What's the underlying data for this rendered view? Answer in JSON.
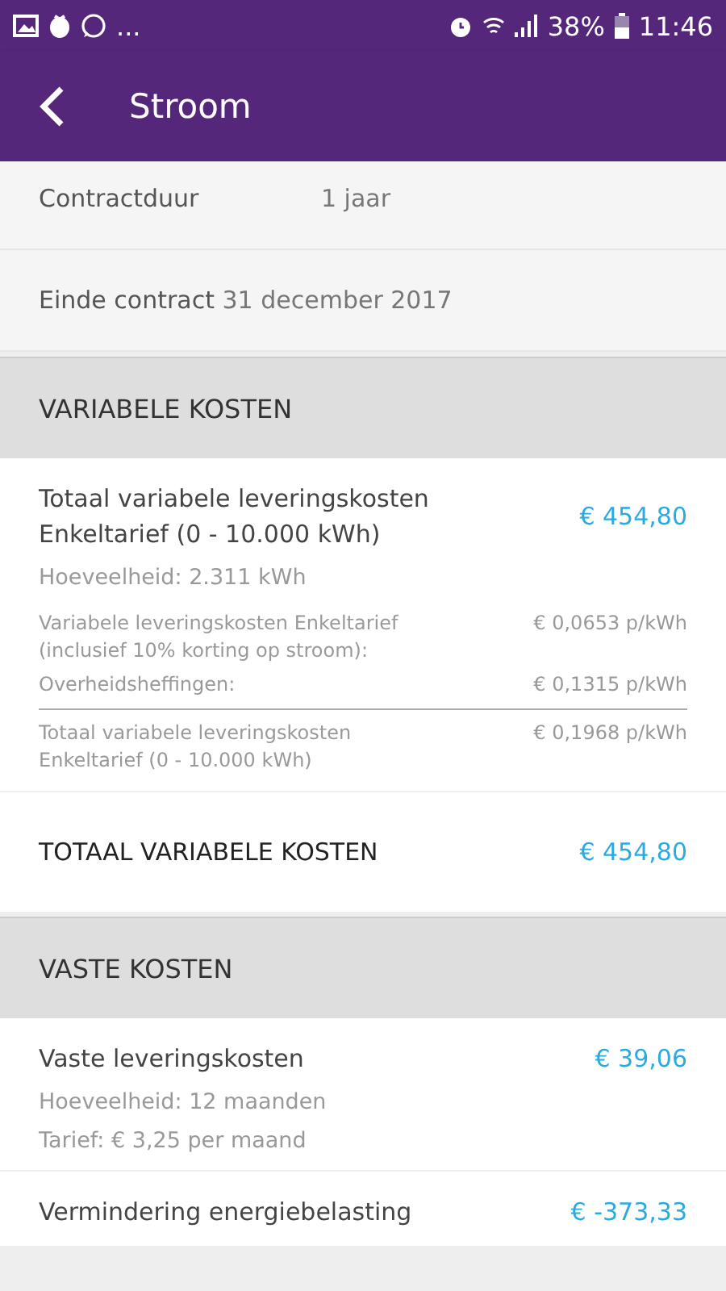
{
  "status_bar": {
    "more": "...",
    "battery": "38%",
    "time": "11:46"
  },
  "header": {
    "title": "Stroom"
  },
  "contract": [
    {
      "label": "Contractduur",
      "value": "1 jaar",
      "kind": "columns"
    },
    {
      "label": "Einde contract",
      "value": "31 december 2017",
      "kind": "inline"
    }
  ],
  "sections": [
    {
      "title": "VARIABELE KOSTEN",
      "items": [
        {
          "kind": "detail",
          "title": "Totaal variabele leveringskosten Enkeltarief (0 - 10.000 kWh)",
          "amount": "€ 454,80",
          "lines": [
            "Hoeveelheid: 2.311 kWh"
          ],
          "breakdown": [
            {
              "label": "Variabele leveringskosten Enkeltarief (inclusief 10% korting op stroom):",
              "value": "€ 0,0653 p/kWh",
              "total": false
            },
            {
              "label": "Overheidsheffingen:",
              "value": "€ 0,1315 p/kWh",
              "total": false
            },
            {
              "label": "Totaal variabele leveringskosten Enkeltarief (0 - 10.000 kWh)",
              "value": "€ 0,1968 p/kWh",
              "total": true
            }
          ]
        },
        {
          "kind": "total",
          "title": "TOTAAL VARIABELE KOSTEN",
          "amount": "€ 454,80"
        }
      ]
    },
    {
      "title": "VASTE KOSTEN",
      "items": [
        {
          "kind": "detail",
          "title": "Vaste leveringskosten",
          "amount": "€ 39,06",
          "lines": [
            "Hoeveelheid: 12 maanden",
            "Tarief: € 3,25 per maand"
          ]
        },
        {
          "kind": "detail",
          "title": "Vermindering energiebelasting",
          "amount": "€ -373,33"
        }
      ]
    }
  ]
}
